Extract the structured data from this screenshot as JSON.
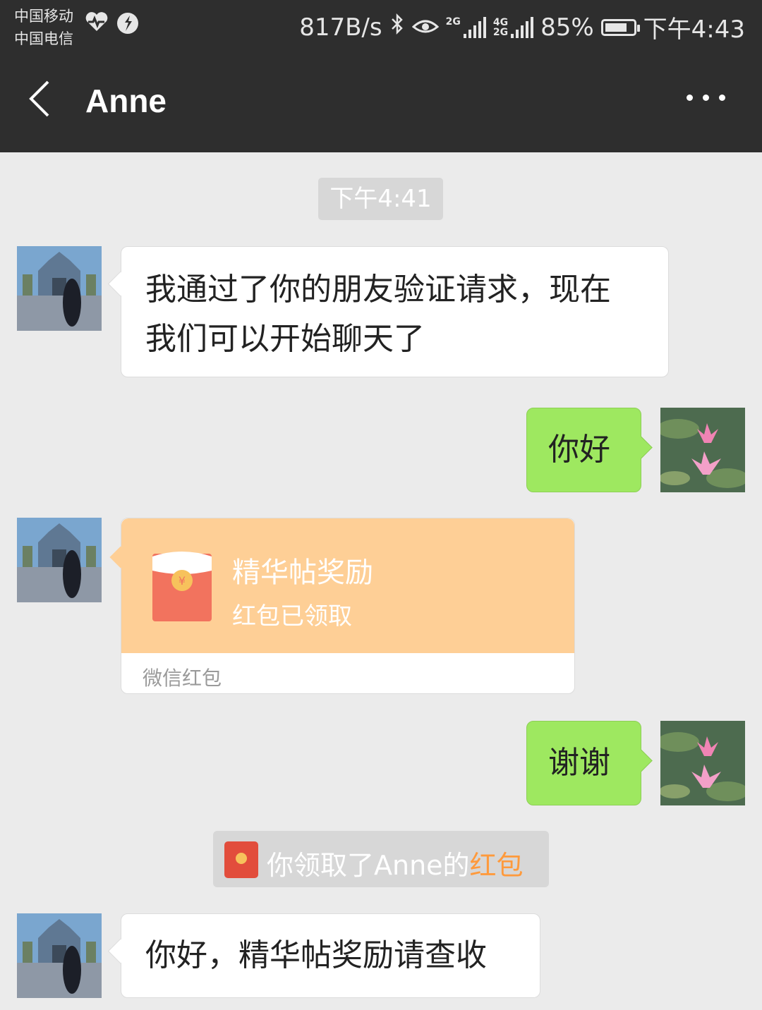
{
  "status_bar": {
    "carrier_1": "中国移动",
    "carrier_2": "中国电信",
    "net_speed": "817B/s",
    "signal_tag_1": "2G",
    "signal_tag_2a": "4G",
    "signal_tag_2b": "2G",
    "battery": "85%",
    "battery_level": 0.85,
    "time": "下午4:43"
  },
  "header": {
    "title": "Anne"
  },
  "chat": {
    "timestamp": "下午4:41",
    "messages": [
      {
        "from": "Anne",
        "text_line1": "我通过了你的朋友验证请求，现在",
        "text_line2": "我们可以开始聊天了"
      },
      {
        "from": "me",
        "text": "你好"
      },
      {
        "from": "Anne",
        "type": "red_packet",
        "title": "精华帖奖励",
        "status": "红包已领取",
        "footer": "微信红包"
      },
      {
        "from": "me",
        "text": "谢谢"
      },
      {
        "from": "system",
        "text_prefix": "你领取了Anne的",
        "text_link": "红包"
      },
      {
        "from": "Anne",
        "text": "你好，精华帖奖励请查收"
      }
    ]
  },
  "colors": {
    "title_bar": "#2e2e2e",
    "chat_bg": "#ebebeb",
    "my_bubble": "#9ee860",
    "red_packet": "#fecf96",
    "link": "#ff9a3c"
  }
}
